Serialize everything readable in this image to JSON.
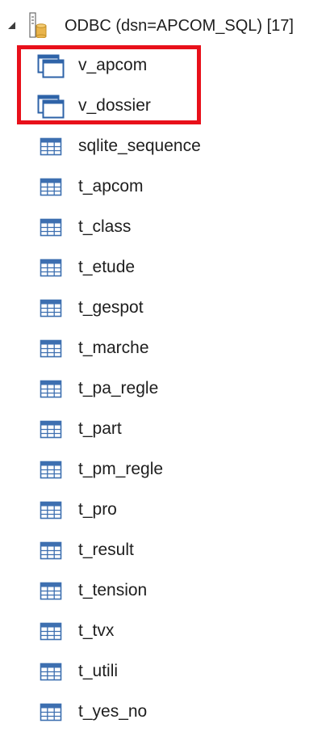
{
  "root": {
    "label": "ODBC (dsn=APCOM_SQL) [17]",
    "expander_icon": "expanded-triangle-icon",
    "icon": "database-connection-icon"
  },
  "items": [
    {
      "label": "v_apcom",
      "kind": "view",
      "icon": "view-icon"
    },
    {
      "label": "v_dossier",
      "kind": "view",
      "icon": "view-icon"
    },
    {
      "label": "sqlite_sequence",
      "kind": "table",
      "icon": "table-icon"
    },
    {
      "label": "t_apcom",
      "kind": "table",
      "icon": "table-icon"
    },
    {
      "label": "t_class",
      "kind": "table",
      "icon": "table-icon"
    },
    {
      "label": "t_etude",
      "kind": "table",
      "icon": "table-icon"
    },
    {
      "label": "t_gespot",
      "kind": "table",
      "icon": "table-icon"
    },
    {
      "label": "t_marche",
      "kind": "table",
      "icon": "table-icon"
    },
    {
      "label": "t_pa_regle",
      "kind": "table",
      "icon": "table-icon"
    },
    {
      "label": "t_part",
      "kind": "table",
      "icon": "table-icon"
    },
    {
      "label": "t_pm_regle",
      "kind": "table",
      "icon": "table-icon"
    },
    {
      "label": "t_pro",
      "kind": "table",
      "icon": "table-icon"
    },
    {
      "label": "t_result",
      "kind": "table",
      "icon": "table-icon"
    },
    {
      "label": "t_tension",
      "kind": "table",
      "icon": "table-icon"
    },
    {
      "label": "t_tvx",
      "kind": "table",
      "icon": "table-icon"
    },
    {
      "label": "t_utili",
      "kind": "table",
      "icon": "table-icon"
    },
    {
      "label": "t_yes_no",
      "kind": "table",
      "icon": "table-icon"
    }
  ],
  "colors": {
    "highlight": "#e8101a",
    "icon_blue": "#2e63a8",
    "table_line": "#3d6fb0",
    "db_gold": "#e9b44c",
    "text": "#1e1e1e"
  }
}
